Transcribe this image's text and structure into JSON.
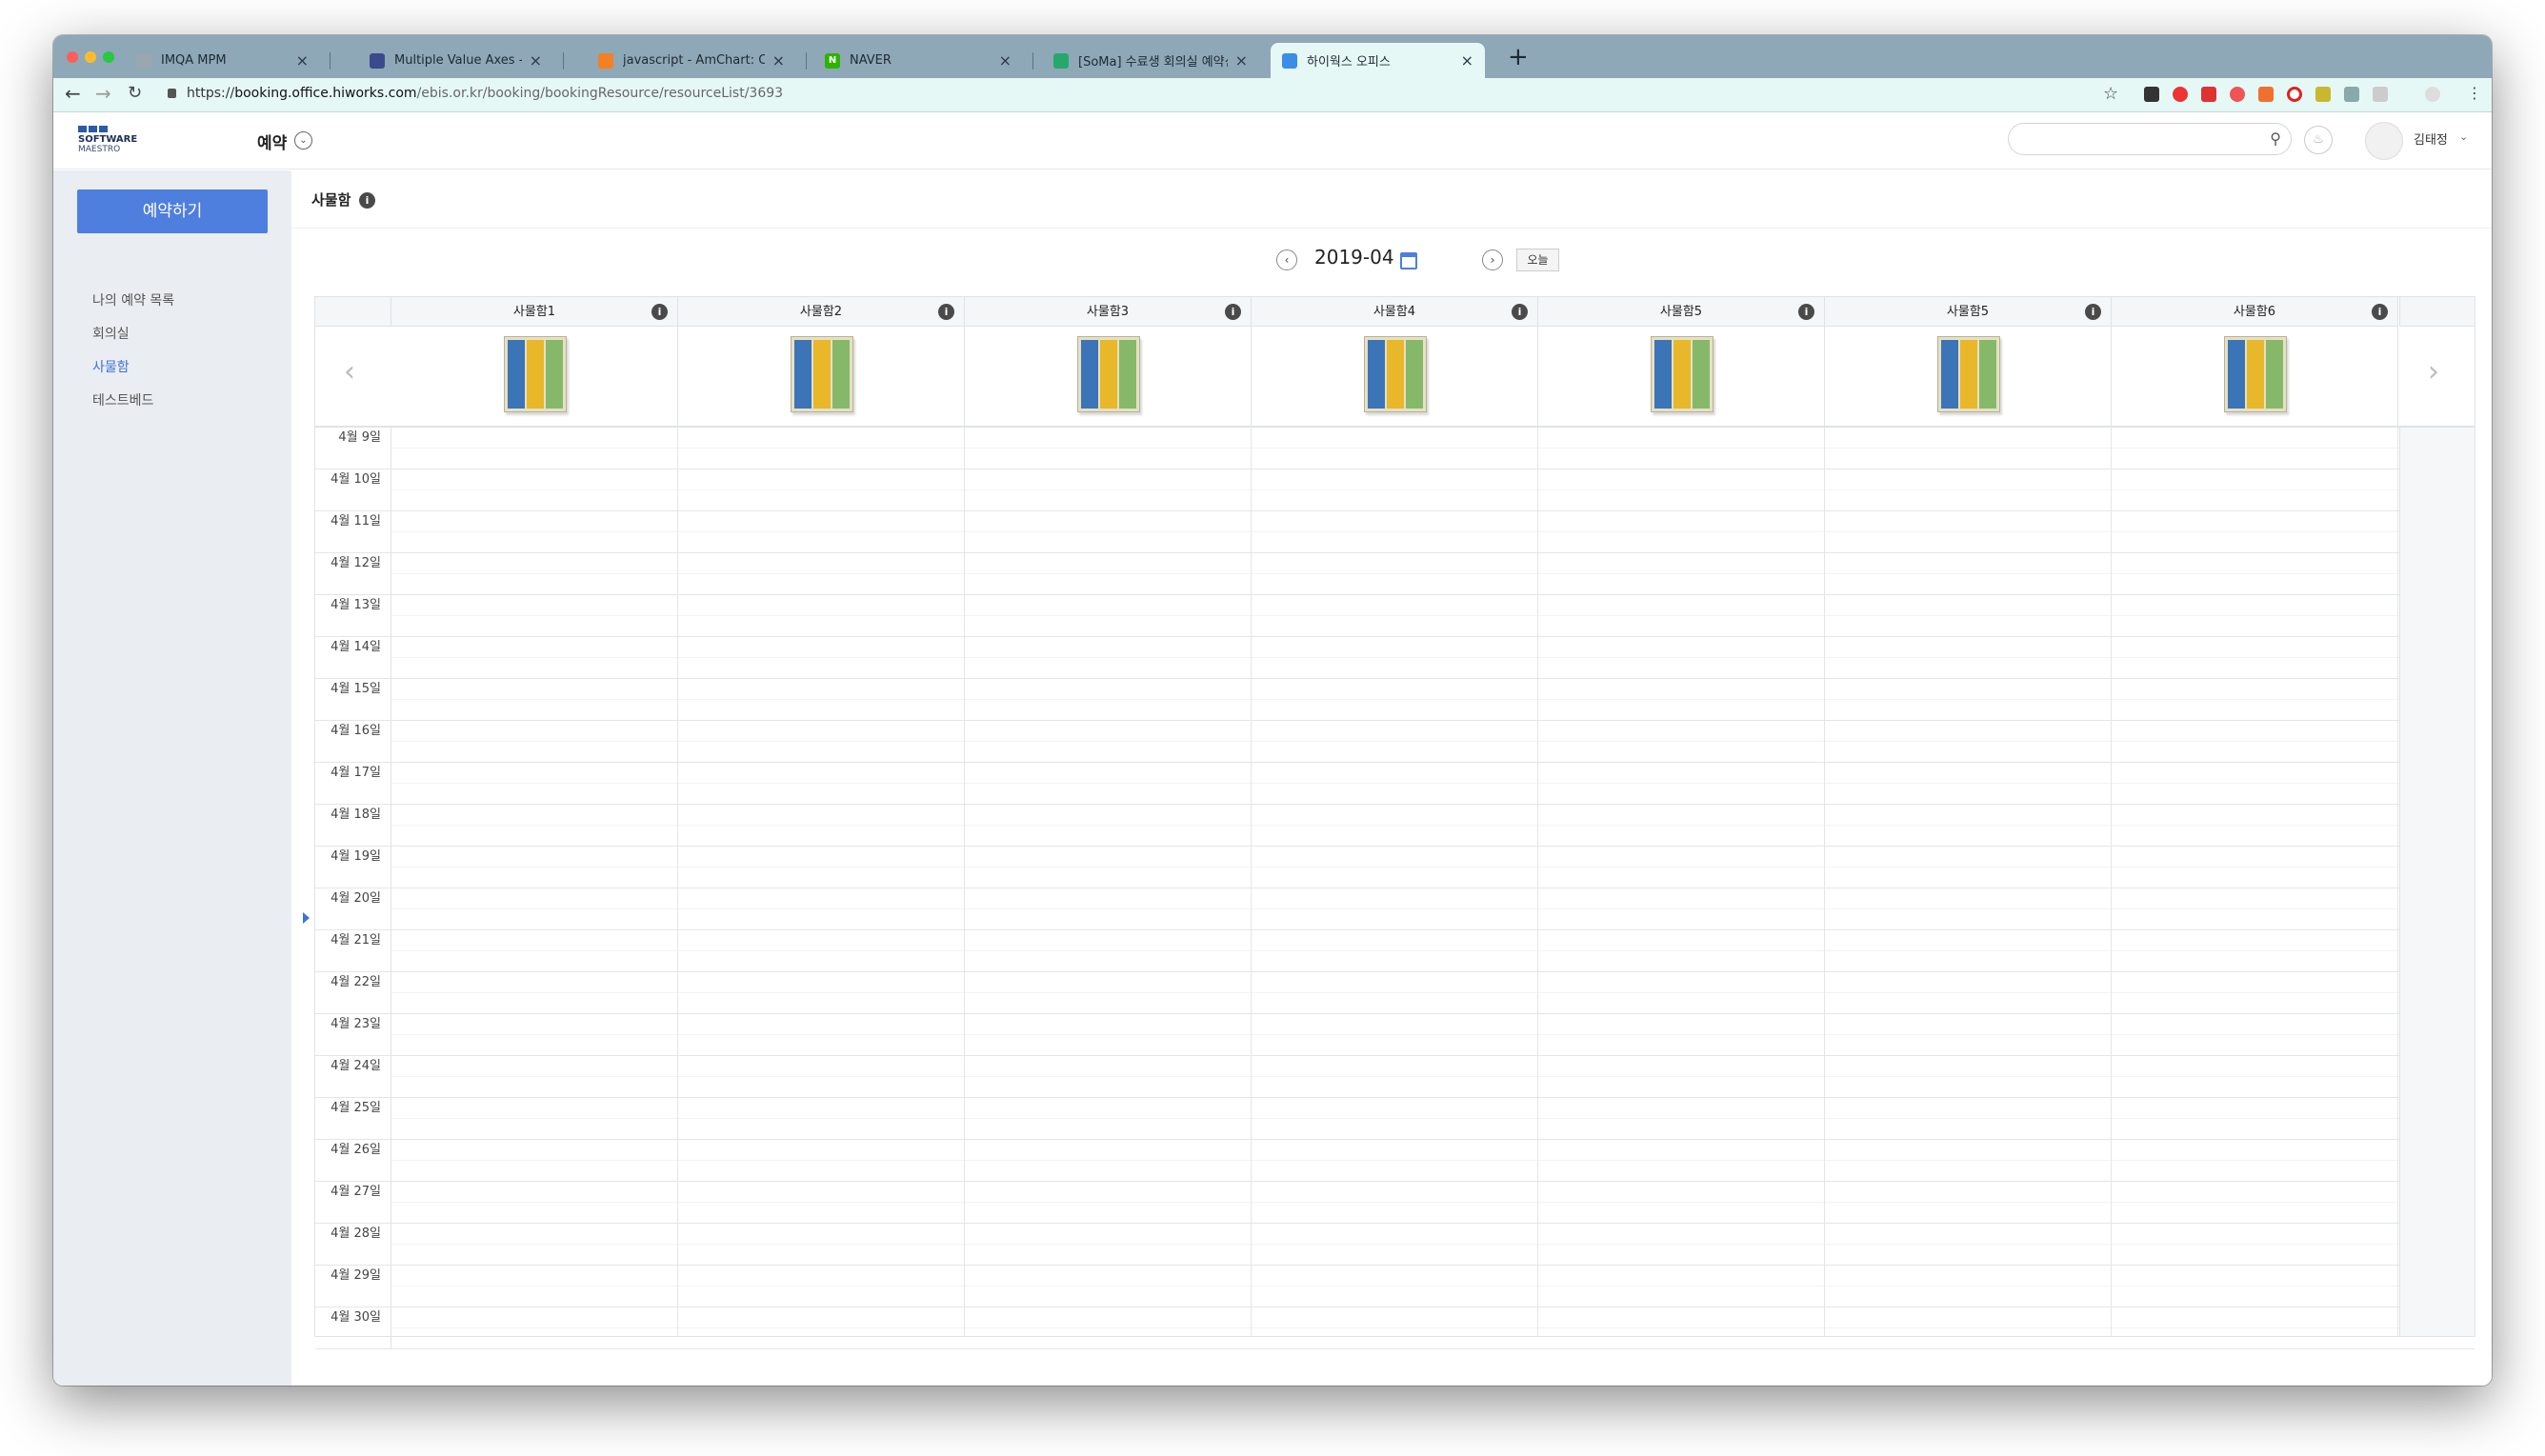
{
  "browser": {
    "tabs": [
      {
        "label": "IMQA MPM",
        "fav_color": "#9aa7b0",
        "fav_text": ""
      },
      {
        "label": "Multiple Value Axes - amChart",
        "fav_color": "#3b4a8c",
        "fav_text": ""
      },
      {
        "label": "javascript - AmChart: Change",
        "fav_color": "#f48024",
        "fav_text": ""
      },
      {
        "label": "NAVER",
        "fav_color": "#2db400",
        "fav_text": "N"
      },
      {
        "label": "[SoMa] 수료생 회의실 예약신청 방",
        "fav_color": "#27a86b",
        "fav_text": ""
      },
      {
        "label": "하이웍스 오피스",
        "fav_color": "#3a8ee6",
        "fav_text": ""
      }
    ],
    "active_tab_index": 5,
    "url_prefix": "https://",
    "url_host": "booking.office.hiworks.com",
    "url_path": "/ebis.or.kr/booking/bookingResource/resourceList/3693"
  },
  "header": {
    "logo_line1": "SOFTWARE",
    "logo_line2": "MAESTRO",
    "menu_title": "예약",
    "user_name": "김태정"
  },
  "sidebar": {
    "reserve_button": "예약하기",
    "items": [
      {
        "label": "나의 예약 목록",
        "active": false
      },
      {
        "label": "회의실",
        "active": false
      },
      {
        "label": "사물함",
        "active": true
      },
      {
        "label": "테스트베드",
        "active": false
      }
    ]
  },
  "page": {
    "title": "사물함",
    "month": "2019-04",
    "today_button": "오늘"
  },
  "resources": [
    "사물함1",
    "사물함2",
    "사물함3",
    "사물함4",
    "사물함5",
    "사물함5",
    "사물함6"
  ],
  "dates": [
    "4월 9일",
    "4월 10일",
    "4월 11일",
    "4월 12일",
    "4월 13일",
    "4월 14일",
    "4월 15일",
    "4월 16일",
    "4월 17일",
    "4월 18일",
    "4월 19일",
    "4월 20일",
    "4월 21일",
    "4월 22일",
    "4월 23일",
    "4월 24일",
    "4월 25일",
    "4월 26일",
    "4월 27일",
    "4월 28일",
    "4월 29일",
    "4월 30일"
  ],
  "today_date": "4월 17일",
  "colors": {
    "accent": "#4e7fde",
    "active_link": "#3d73d9",
    "locker_blue": "#3c74b8",
    "locker_yellow": "#e8b72a",
    "locker_green": "#86b86a"
  }
}
